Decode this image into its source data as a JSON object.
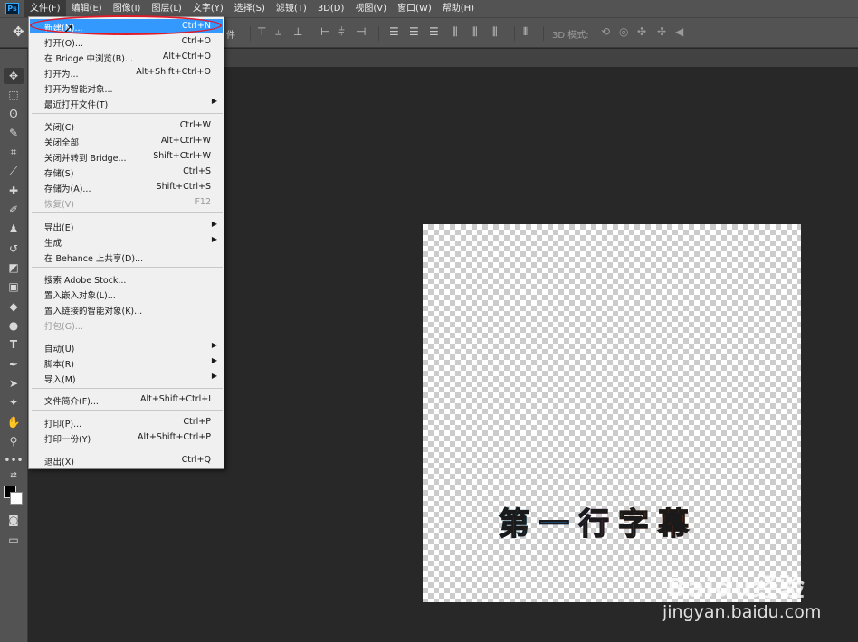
{
  "menubar": {
    "logo": "Ps",
    "items": [
      "文件(F)",
      "编辑(E)",
      "图像(I)",
      "图层(L)",
      "文字(Y)",
      "选择(S)",
      "滤镜(T)",
      "3D(D)",
      "视图(V)",
      "窗口(W)",
      "帮助(H)"
    ]
  },
  "optionsbar": {
    "file_label": "件",
    "mode_3d_label": "3D 模式:"
  },
  "file_menu": {
    "items": [
      {
        "label": "新建(N)...",
        "shortcut": "Ctrl+N",
        "highlighted": true
      },
      {
        "label": "打开(O)...",
        "shortcut": "Ctrl+O"
      },
      {
        "label": "在 Bridge 中浏览(B)...",
        "shortcut": "Alt+Ctrl+O"
      },
      {
        "label": "打开为...",
        "shortcut": "Alt+Shift+Ctrl+O"
      },
      {
        "label": "打开为智能对象...",
        "shortcut": ""
      },
      {
        "label": "最近打开文件(T)",
        "shortcut": "",
        "submenu": true
      },
      {
        "label": "关闭(C)",
        "shortcut": "Ctrl+W"
      },
      {
        "label": "关闭全部",
        "shortcut": "Alt+Ctrl+W"
      },
      {
        "label": "关闭并转到 Bridge...",
        "shortcut": "Shift+Ctrl+W"
      },
      {
        "label": "存储(S)",
        "shortcut": "Ctrl+S"
      },
      {
        "label": "存储为(A)...",
        "shortcut": "Shift+Ctrl+S"
      },
      {
        "label": "恢复(V)",
        "shortcut": "F12",
        "disabled": true
      },
      {
        "label": "导出(E)",
        "shortcut": "",
        "submenu": true
      },
      {
        "label": "生成",
        "shortcut": "",
        "submenu": true
      },
      {
        "label": "在 Behance 上共享(D)...",
        "shortcut": ""
      },
      {
        "label": "搜索 Adobe Stock...",
        "shortcut": ""
      },
      {
        "label": "置入嵌入对象(L)...",
        "shortcut": ""
      },
      {
        "label": "置入链接的智能对象(K)...",
        "shortcut": ""
      },
      {
        "label": "打包(G)...",
        "shortcut": "",
        "disabled": true
      },
      {
        "label": "自动(U)",
        "shortcut": "",
        "submenu": true
      },
      {
        "label": "脚本(R)",
        "shortcut": "",
        "submenu": true
      },
      {
        "label": "导入(M)",
        "shortcut": "",
        "submenu": true
      },
      {
        "label": "文件简介(F)...",
        "shortcut": "Alt+Shift+Ctrl+I"
      },
      {
        "label": "打印(P)...",
        "shortcut": "Ctrl+P"
      },
      {
        "label": "打印一份(Y)",
        "shortcut": "Alt+Shift+Ctrl+P"
      },
      {
        "label": "退出(X)",
        "shortcut": "Ctrl+Q"
      }
    ]
  },
  "canvas": {
    "subtitle_chars": [
      "第",
      "一",
      "行",
      "字",
      "幕"
    ]
  },
  "watermark": {
    "brand": "Baidu经验",
    "url": "jingyan.baidu.com"
  },
  "colors": {
    "highlight": "#3399ff",
    "annotation": "#e11b2b",
    "chrome": "#535353",
    "workspace": "#282828"
  },
  "icons": {
    "toolbar": [
      "move-icon",
      "marquee-icon",
      "lasso-icon",
      "quick-select-icon",
      "crop-icon",
      "eyedropper-icon",
      "healing-brush-icon",
      "brush-icon",
      "clone-stamp-icon",
      "history-brush-icon",
      "eraser-icon",
      "gradient-icon",
      "blur-icon",
      "dodge-icon",
      "type-icon",
      "pen-icon",
      "path-select-icon",
      "shape-icon",
      "hand-icon",
      "zoom-icon",
      "more-tools-icon"
    ]
  }
}
